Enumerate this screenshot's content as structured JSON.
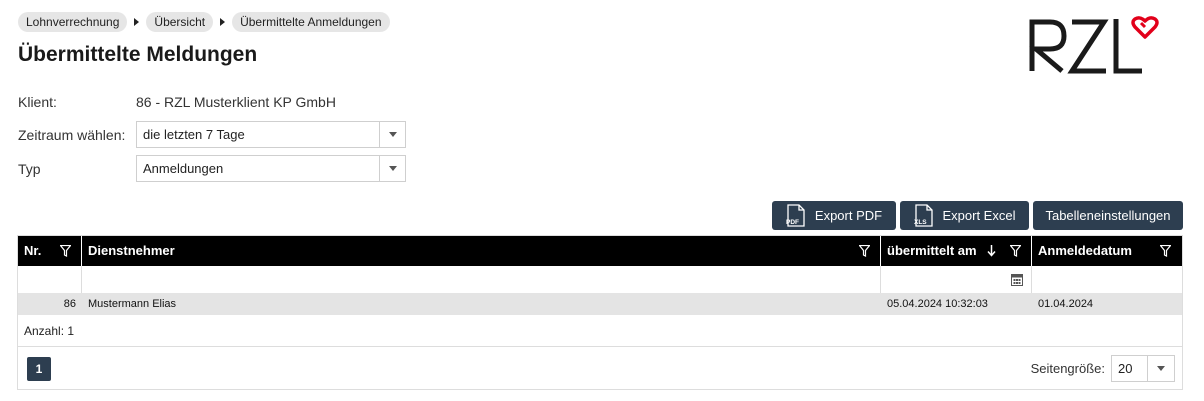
{
  "breadcrumb": [
    "Lohnverrechnung",
    "Übersicht",
    "Übermittelte Anmeldungen"
  ],
  "page_title": "Übermittelte Meldungen",
  "logo": {
    "text": "RZL",
    "heart_color": "#e2001a"
  },
  "form": {
    "client_label": "Klient:",
    "client_value": "86 - RZL Musterklient KP GmbH",
    "period_label": "Zeitraum wählen:",
    "period_value": "die letzten 7 Tage",
    "type_label": "Typ",
    "type_value": "Anmeldungen"
  },
  "toolbar": {
    "export_pdf": "Export PDF",
    "pdf_icon_text": "PDF",
    "export_excel": "Export Excel",
    "xls_icon_text": "XLS",
    "table_settings": "Tabelleneinstellungen"
  },
  "table": {
    "columns": {
      "nr": "Nr.",
      "employee": "Dienstnehmer",
      "sent_at": "übermittelt am",
      "registration_date": "Anmeldedatum"
    },
    "rows": [
      {
        "nr": "86",
        "employee": "Mustermann Elias",
        "sent_at": "05.04.2024 10:32:03",
        "registration_date": "01.04.2024"
      }
    ],
    "count_text": "Anzahl: 1"
  },
  "pager": {
    "current_page": "1",
    "page_size_label": "Seitengröße:",
    "page_size_value": "20"
  },
  "colors": {
    "header_bg": "#000000",
    "button_bg": "#2d3e50",
    "row_bg": "#e4e4e4"
  }
}
